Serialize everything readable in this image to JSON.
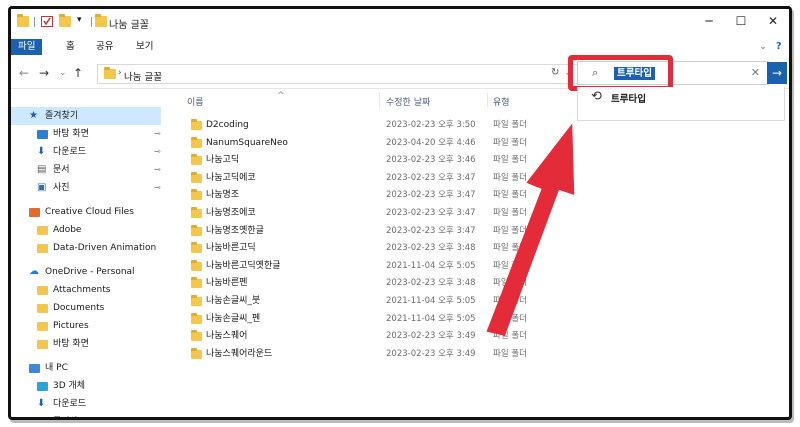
{
  "window": {
    "title": "나눔 글꼴",
    "minimize": "─",
    "maximize": "☐",
    "close": "✕"
  },
  "ribbon": {
    "tabs": [
      {
        "label": "파일",
        "active": true
      },
      {
        "label": "홈",
        "active": false
      },
      {
        "label": "공유",
        "active": false
      },
      {
        "label": "보기",
        "active": false
      }
    ],
    "expand": "⌄",
    "help": "?"
  },
  "navigation": {
    "back": "←",
    "forward": "→",
    "recent": "⌄",
    "up": "↑",
    "path_separator": "›",
    "path": "나눔 글꼴",
    "address_dropdown": "⌄",
    "refresh": "↻"
  },
  "search": {
    "value": "트루타입",
    "clear": "✕",
    "go": "→",
    "suggestion": "트루타입"
  },
  "columns": {
    "name": "이름",
    "date": "수정한 날짜",
    "type": "유형",
    "sort_indicator": "^"
  },
  "sidebar": {
    "items": [
      {
        "label": "즐겨찾기",
        "icon": "star-icon",
        "pinned": false,
        "selected": true,
        "indent": 0
      },
      {
        "label": "바탕 화면",
        "icon": "desktop-icon",
        "pinned": true,
        "indent": 1
      },
      {
        "label": "다운로드",
        "icon": "download-icon",
        "pinned": true,
        "indent": 1
      },
      {
        "label": "문서",
        "icon": "document-icon",
        "pinned": true,
        "indent": 1
      },
      {
        "label": "사진",
        "icon": "picture-icon",
        "pinned": true,
        "indent": 1
      },
      {
        "label": "Creative Cloud Files",
        "icon": "creative-cloud-icon",
        "pinned": false,
        "indent": 0
      },
      {
        "label": "Adobe",
        "icon": "folder-icon",
        "pinned": false,
        "indent": 1
      },
      {
        "label": "Data-Driven Animation",
        "icon": "folder-icon",
        "pinned": false,
        "indent": 1
      },
      {
        "label": "OneDrive - Personal",
        "icon": "cloud-icon",
        "pinned": false,
        "indent": 0
      },
      {
        "label": "Attachments",
        "icon": "folder-icon",
        "pinned": false,
        "indent": 1
      },
      {
        "label": "Documents",
        "icon": "folder-icon",
        "pinned": false,
        "indent": 1
      },
      {
        "label": "Pictures",
        "icon": "folder-icon",
        "pinned": false,
        "indent": 1
      },
      {
        "label": "바탕 화면",
        "icon": "folder-icon",
        "pinned": false,
        "indent": 1
      },
      {
        "label": "내 PC",
        "icon": "pc-icon",
        "pinned": false,
        "indent": 0
      },
      {
        "label": "3D 개체",
        "icon": "cube-icon",
        "pinned": false,
        "indent": 1
      },
      {
        "label": "다운로드",
        "icon": "download-icon",
        "pinned": false,
        "indent": 1
      },
      {
        "label": "동영상",
        "icon": "video-icon",
        "pinned": false,
        "indent": 1
      }
    ],
    "pin_glyph": "📌"
  },
  "files": [
    {
      "name": "D2coding",
      "date": "2023-02-23 오후 3:50",
      "type": "파일 폴더"
    },
    {
      "name": "NanumSquareNeo",
      "date": "2023-04-20 오후 4:46",
      "type": "파일 폴더"
    },
    {
      "name": "나눔고딕",
      "date": "2023-02-23 오후 3:46",
      "type": "파일 폴더"
    },
    {
      "name": "나눔고딕에코",
      "date": "2023-02-23 오후 3:47",
      "type": "파일 폴더"
    },
    {
      "name": "나눔명조",
      "date": "2023-02-23 오후 3:47",
      "type": "파일 폴더"
    },
    {
      "name": "나눔명조에코",
      "date": "2023-02-23 오후 3:47",
      "type": "파일 폴더"
    },
    {
      "name": "나눔명조옛한글",
      "date": "2023-02-23 오후 3:47",
      "type": "파일 폴더"
    },
    {
      "name": "나눔바른고딕",
      "date": "2023-02-23 오후 3:48",
      "type": "파일 폴더"
    },
    {
      "name": "나눔바른고딕옛한글",
      "date": "2021-11-04 오후 5:05",
      "type": "파일 폴더"
    },
    {
      "name": "나눔바른펜",
      "date": "2023-02-23 오후 3:48",
      "type": "파일 폴더"
    },
    {
      "name": "나눔손글씨_붓",
      "date": "2021-11-04 오후 5:05",
      "type": "파일 폴더"
    },
    {
      "name": "나눔손글씨_펜",
      "date": "2021-11-04 오후 5:05",
      "type": "파일 폴더"
    },
    {
      "name": "나눔스퀘어",
      "date": "2023-02-23 오후 3:49",
      "type": "파일 폴더"
    },
    {
      "name": "나눔스퀘어라운드",
      "date": "2023-02-23 오후 3:49",
      "type": "파일 폴더"
    }
  ],
  "colors": {
    "accent": "#1c60b0",
    "highlight_red": "#e32b3a",
    "folder_yellow": "#f3c64c",
    "selected_bg": "#cde8ff"
  }
}
